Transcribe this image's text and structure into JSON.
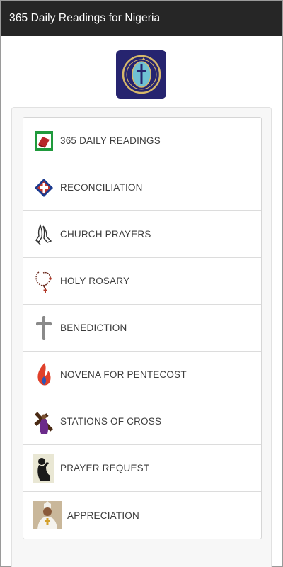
{
  "app": {
    "title": "365 Daily Readings for Nigeria"
  },
  "logo": {
    "icon": "church-emblem-icon",
    "bg_color": "#26246f",
    "accent_color": "#d7b86a"
  },
  "menu": {
    "items": [
      {
        "label": "365 DAILY READINGS",
        "icon": "bible-book-icon"
      },
      {
        "label": "RECONCILIATION",
        "icon": "reconciliation-icon"
      },
      {
        "label": "CHURCH PRAYERS",
        "icon": "praying-hands-icon"
      },
      {
        "label": "HOLY ROSARY",
        "icon": "rosary-icon"
      },
      {
        "label": "BENEDICTION",
        "icon": "cross-icon"
      },
      {
        "label": "NOVENA FOR PENTECOST",
        "icon": "flame-icon"
      },
      {
        "label": "STATIONS OF CROSS",
        "icon": "stations-cross-icon"
      },
      {
        "label": "PRAYER REQUEST",
        "icon": "kneeling-prayer-icon"
      },
      {
        "label": "APPRECIATION",
        "icon": "bishop-portrait-icon"
      }
    ]
  }
}
